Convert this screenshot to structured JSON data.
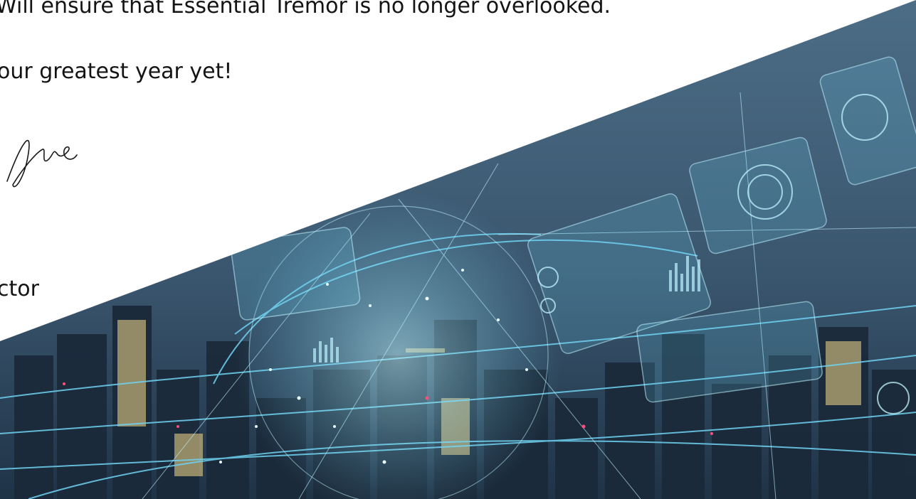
{
  "letter": {
    "line1": "Will ensure that Essential Tremor is no longer overlooked.",
    "line2": "our greatest year yet!",
    "signature_text": "les",
    "title_fragment": "ctor"
  },
  "image": {
    "subject": "city-skyline-with-digital-network-overlay",
    "colors": {
      "sky": "#3d5a73",
      "accent": "#6fd3f2",
      "glow": "#bff4ff",
      "building": "#1b2a3a"
    }
  }
}
